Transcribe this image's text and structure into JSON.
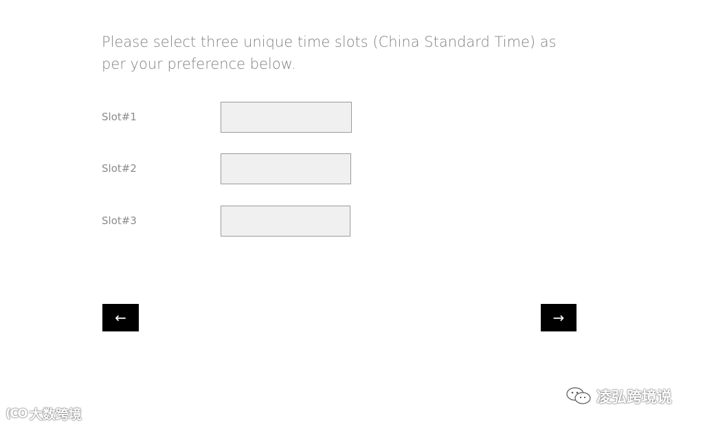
{
  "instructions": "Please select three unique time slots (China Standard Time) as per your preference below.",
  "slots": [
    {
      "label": "Slot#1",
      "value": "",
      "placeholder": ""
    },
    {
      "label": "Slot#2",
      "value": "",
      "placeholder": ""
    },
    {
      "label": "Slot#3",
      "value": "",
      "placeholder": ""
    }
  ],
  "nav": {
    "back_label": "←",
    "next_label": "→"
  },
  "watermarks": {
    "left_logo": "(CO",
    "left_text": "大数跨境",
    "right_icon": "wechat-icon",
    "right_text": "凌弘跨境说"
  }
}
